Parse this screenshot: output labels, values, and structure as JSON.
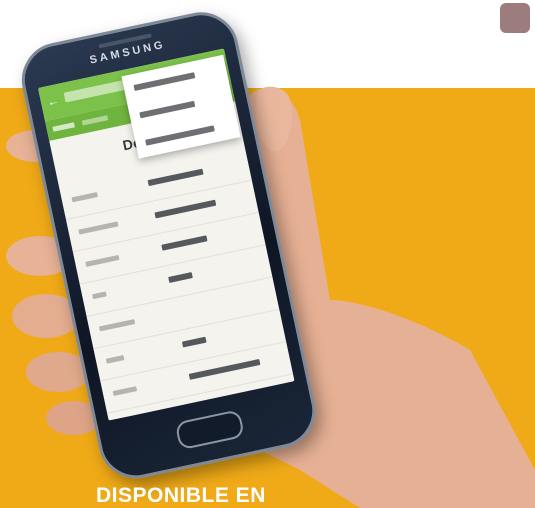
{
  "phone": {
    "brand": "SAMSUNG"
  },
  "screen": {
    "detail_title": "Detalle",
    "rows": [
      {
        "label_w": 26,
        "value_w": 56
      },
      {
        "label_w": 40,
        "value_w": 62
      },
      {
        "label_w": 34,
        "value_w": 46
      },
      {
        "label_w": 14,
        "value_w": 24
      },
      {
        "label_w": 36,
        "value_w": 0
      },
      {
        "label_w": 18,
        "value_w": 24
      },
      {
        "label_w": 24,
        "value_w": 72
      },
      {
        "label_w": 36,
        "value_w": 20
      },
      {
        "label_w": 32,
        "value_w": 36
      }
    ]
  },
  "banner": {
    "text": "DISPONIBLE EN"
  },
  "colors": {
    "orange": "#f0aa17",
    "app_green": "#7cc14a",
    "corner_square": "#9c7c7c",
    "skin": "#e8b39a"
  }
}
